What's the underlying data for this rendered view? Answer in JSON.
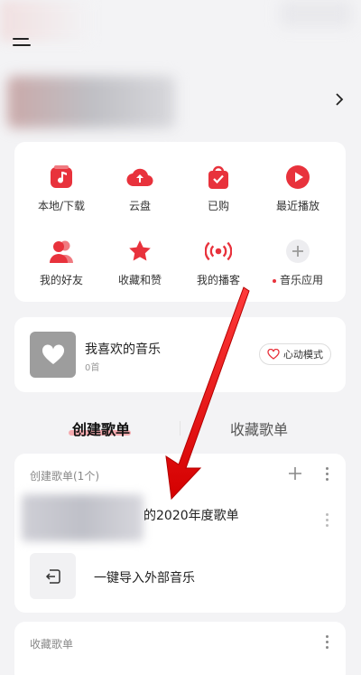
{
  "header": {
    "menu_icon": "menu-icon",
    "profile_arrow_icon": "chevron-right-icon"
  },
  "quick_grid": [
    {
      "label": "本地/下载",
      "icon": "music-note-icon"
    },
    {
      "label": "云盘",
      "icon": "cloud-upload-icon"
    },
    {
      "label": "已购",
      "icon": "shopping-bag-icon"
    },
    {
      "label": "最近播放",
      "icon": "play-circle-icon"
    },
    {
      "label": "我的好友",
      "icon": "friends-icon"
    },
    {
      "label": "收藏和赞",
      "icon": "star-icon"
    },
    {
      "label": "我的播客",
      "icon": "broadcast-icon"
    },
    {
      "label": "音乐应用",
      "icon": "plus-circle-icon"
    }
  ],
  "favorites": {
    "title": "我喜欢的音乐",
    "count": "0首",
    "mode_label": "心动模式"
  },
  "tabs": {
    "created": "创建歌单",
    "collected": "收藏歌单"
  },
  "created_section": {
    "title": "创建歌单(1个)",
    "playlist_name": "的2020年度歌单",
    "import_label": "一键导入外部音乐"
  },
  "collected_section": {
    "title": "收藏歌单"
  },
  "colors": {
    "accent": "#e8323c",
    "background": "#f3f3f5",
    "card": "#ffffff"
  }
}
